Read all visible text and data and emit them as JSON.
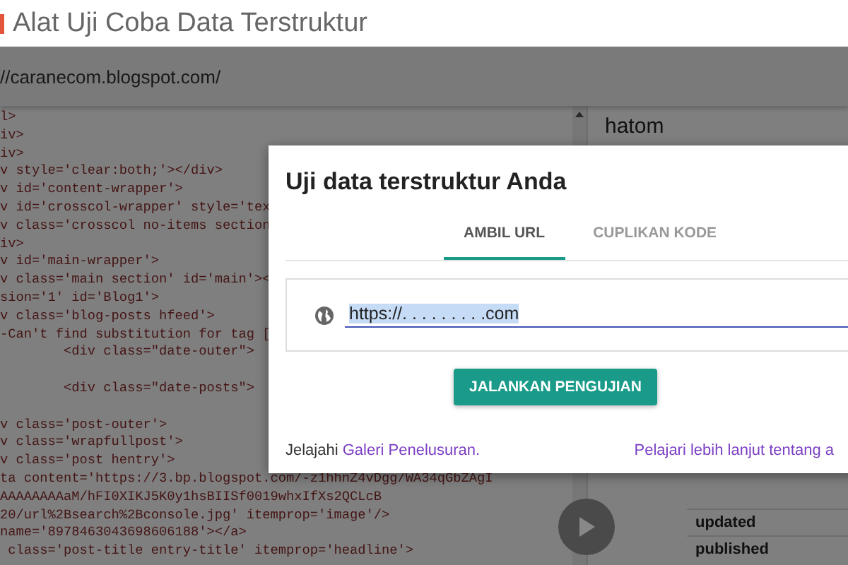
{
  "window": {
    "title": "Alat Uji Coba Data Terstruktur"
  },
  "address_bar": {
    "url": "//caranecom.blogspot.com/"
  },
  "code_lines": [
    {
      "text": "l>",
      "blank_after": false
    },
    {
      "text": "iv>",
      "blank_after": false
    },
    {
      "text": "iv>",
      "blank_after": false
    },
    {
      "text": "v style='clear:both;'></div>",
      "blank_after": false
    },
    {
      "text": "v id='content-wrapper'>",
      "blank_after": false
    },
    {
      "text": "v id='crosscol-wrapper' style='tex",
      "blank_after": false
    },
    {
      "text": "v class='crosscol no-items section",
      "blank_after": false
    },
    {
      "text": "iv>",
      "blank_after": false
    },
    {
      "text": "v id='main-wrapper'>",
      "blank_after": false
    },
    {
      "text": "v class='main section' id='main'><",
      "blank_after": false
    },
    {
      "text": "sion='1' id='Blog1'>",
      "blank_after": false
    },
    {
      "text": "v class='blog-posts hfeed'>",
      "blank_after": false
    },
    {
      "text": "-Can't find substitution for tag [",
      "blank_after": false
    },
    {
      "text": "        <div class=\"date-outer\">",
      "blank_after": true
    },
    {
      "text": "        <div class=\"date-posts\">",
      "blank_after": true
    },
    {
      "text": "v class='post-outer'>",
      "blank_after": false
    },
    {
      "text": "v class='wrapfullpost'>",
      "blank_after": false
    },
    {
      "text": "v class='post hentry'>",
      "blank_after": false
    },
    {
      "text": "ta content='https://3.bp.blogspot.com/-z1hhnZ4vDgg/WA34qGbZAgI",
      "blank_after": false
    },
    {
      "text": "AAAAAAAAaM/hFI0XIKJ5K0y1hsBIISf0019whxIfXs2QCLcB",
      "blank_after": false
    },
    {
      "text": "20/url%2Bsearch%2Bconsole.jpg' itemprop='image'/>",
      "blank_after": false
    },
    {
      "text": "name='8978463043698606188'></a>",
      "blank_after": false
    },
    {
      "text": " class='post-title entry-title' itemprop='headline'>",
      "blank_after": false
    }
  ],
  "results_panel": {
    "heading": "hatom",
    "rows": [
      "updated",
      "published"
    ]
  },
  "dialog": {
    "title": "Uji data terstruktur Anda",
    "tabs": [
      {
        "label": "AMBIL URL",
        "selected": true
      },
      {
        "label": "CUPLIKAN KODE",
        "selected": false
      }
    ],
    "url_field": {
      "value": "https://. . . . . . . . .com",
      "text_selected": true
    },
    "run_button": "JALANKAN PENGUJIAN",
    "footer_text": "Jelajahi",
    "footer_link": "Galeri Penelusuran.",
    "learn_more_link": "Pelajari lebih lanjut tentang a"
  }
}
